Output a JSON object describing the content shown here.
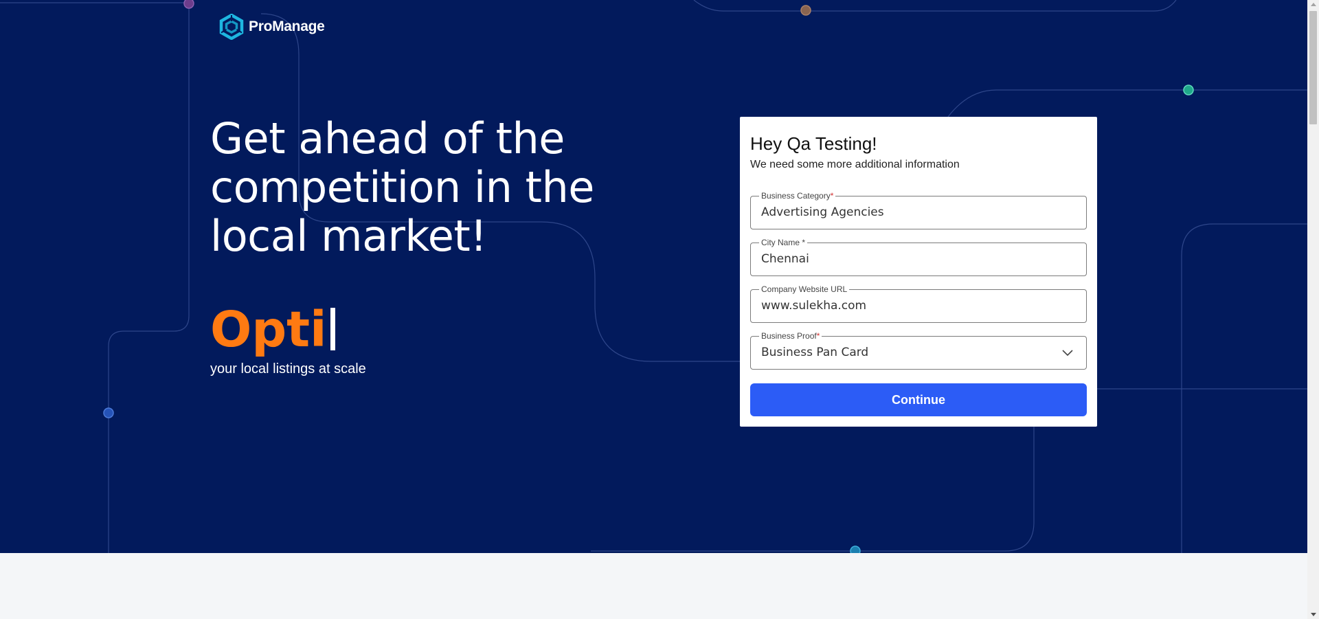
{
  "brand": {
    "name": "ProManage",
    "icon": "promanage-hexagon-logo-icon"
  },
  "hero": {
    "headline": "Get ahead of the competition in the local market!",
    "typed_word": "Opti",
    "tagline": "your local listings at scale"
  },
  "form": {
    "title": "Hey Qa Testing!",
    "subtitle": "We need some more additional information",
    "fields": [
      {
        "label": "Business Category",
        "required_mark": "*",
        "value": "Advertising Agencies"
      },
      {
        "label": "City Name *",
        "value": "Chennai"
      },
      {
        "label": "Company Website URL",
        "value": "www.sulekha.com"
      },
      {
        "label": "Business Proof",
        "required_mark": "*",
        "value": "Business Pan Card",
        "type": "select",
        "icon": "chevron-down-icon"
      }
    ],
    "submit_label": "Continue"
  },
  "colors": {
    "hero_bg": "#021a5c",
    "accent_orange": "#ff7a12",
    "button_blue": "#2c5cf6",
    "footer_bg": "#f4f6f8"
  }
}
